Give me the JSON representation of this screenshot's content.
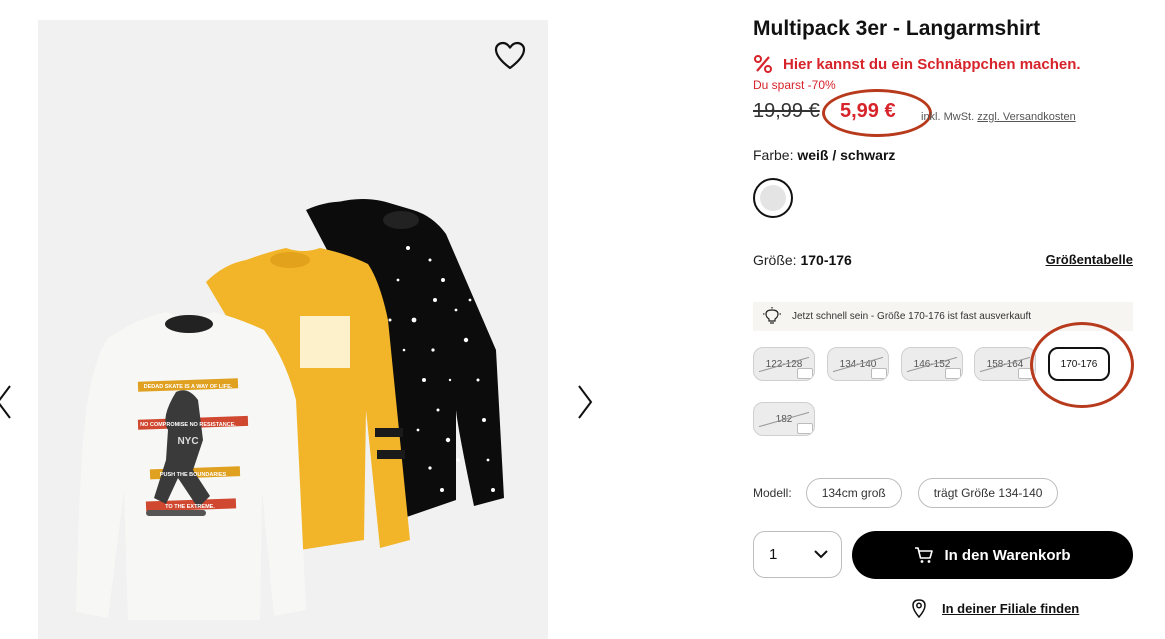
{
  "product": {
    "title": "Multipack 3er - Langarmshirt",
    "deal_text": "Hier kannst du ein Schnäppchen machen.",
    "savings_text": "Du sparst -70%",
    "old_price": "19,99 €",
    "new_price": "5,99 €",
    "tax_prefix": "inkl. MwSt.",
    "tax_link": "zzgl. Versandkosten",
    "color_label": "Farbe:",
    "color_value": "weiß / schwarz",
    "size_label": "Größe:",
    "size_value": "170-176",
    "size_table_link": "Größentabelle",
    "stock_hint": "Jetzt schnell sein - Größe 170-176 ist fast ausverkauft",
    "sizes": [
      {
        "label": "122-128",
        "available": false
      },
      {
        "label": "134-140",
        "available": false
      },
      {
        "label": "146-152",
        "available": false
      },
      {
        "label": "158-164",
        "available": false
      },
      {
        "label": "170-176",
        "available": true,
        "selected": true
      },
      {
        "label": "182",
        "available": false
      }
    ],
    "model_label": "Modell:",
    "model_height": "134cm groß",
    "model_size": "trägt Größe 134-140",
    "quantity": "1",
    "add_to_cart": "In den Warenkorb",
    "find_store": "In deiner Filiale finden"
  },
  "gallery": {
    "shirt_texts": {
      "white_1": "DEDAD SKATE IS A WAY OF LIFE.",
      "white_2": "NO COMPROMISE NO RESISTANCE.",
      "white_3": "PUSH THE BOUNDARIES",
      "white_4": "TO THE EXTREME.",
      "white_nyc": "NYC"
    }
  },
  "colors": {
    "accent_red": "#d7232a",
    "annotation": "#b83a1c",
    "cart_button": "#000000",
    "gallery_bg": "#f1f1f1",
    "shirt_yellow": "#f2b52a",
    "shirt_black": "#0c0c0c",
    "shirt_white": "#f7f7f5"
  },
  "icons": {
    "favorite": "heart-icon",
    "deal": "percent-icon",
    "hint": "lightbulb-icon",
    "cart": "cart-icon",
    "store": "location-pin-icon",
    "quantity": "chevron-down-icon"
  }
}
